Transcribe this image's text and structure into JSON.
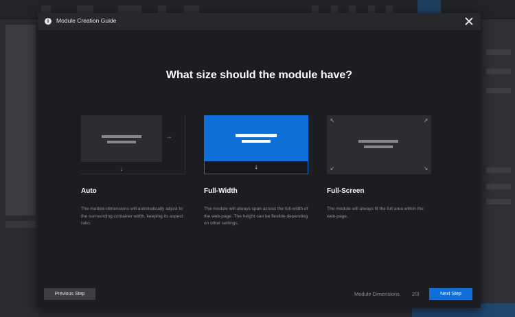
{
  "modal": {
    "title": "Module Creation Guide",
    "question": "What size should the module have?"
  },
  "options": [
    {
      "label": "Auto",
      "description": "The module dimensions will automatically adjust to the surrounding container width, keeping its aspect ratio.",
      "selected": false
    },
    {
      "label": "Full-Width",
      "description": "The module will always span across the full-width of the web-page. The height can be flexible depending on other settings.",
      "selected": true
    },
    {
      "label": "Full-Screen",
      "description": "The module will always fit the full area within the web-page.",
      "selected": false
    }
  ],
  "footer": {
    "previous_label": "Previous Step",
    "step_name": "Module Dimensions",
    "step_count": "2/3",
    "next_label": "Next Step"
  },
  "icons": {
    "info": "info-icon",
    "close": "close-icon",
    "arrow_right": "arrow-right-icon",
    "arrow_down": "arrow-down-icon",
    "expand_corners": "expand-corner-icon"
  },
  "colors": {
    "accent": "#0f6fd8",
    "modal_bg": "#1c1d21",
    "header_bg": "#27282c"
  }
}
